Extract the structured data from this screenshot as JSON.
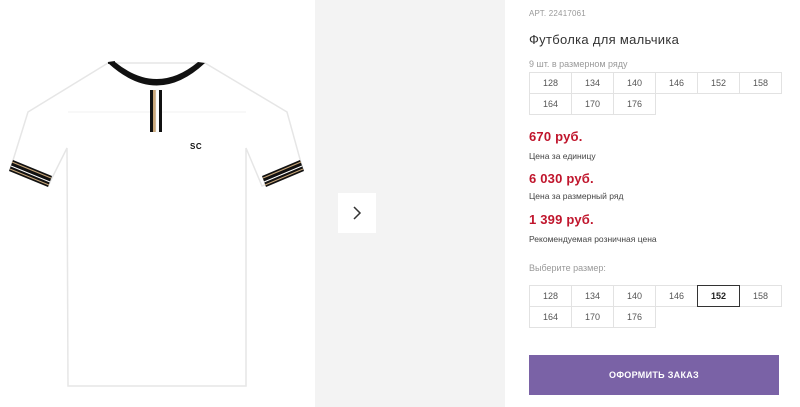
{
  "product": {
    "article": "АРТ. 22417061",
    "title": "Футболка для мальчика",
    "count_in_range": "9 шт. в размерном ряду",
    "range_sizes": [
      "128",
      "134",
      "140",
      "146",
      "152",
      "158",
      "164",
      "170",
      "176"
    ],
    "price_unit": "670 руб.",
    "price_unit_label": "Цена за единицу",
    "price_range": "6 030 руб.",
    "price_range_label": "Цена за размерный ряд",
    "price_retail": "1 399 руб.",
    "price_retail_label": "Рекомендуемая розничная цена",
    "choose_size_label": "Выберите размер:",
    "select_sizes": [
      "128",
      "134",
      "140",
      "146",
      "152",
      "158",
      "164",
      "170",
      "176"
    ],
    "selected_size": "152",
    "shirt_logo": "SC"
  },
  "actions": {
    "order_button": "ОФОРМИТЬ ЗАКАЗ"
  },
  "colors": {
    "accent": "#7a62a6",
    "price": "#c0152c"
  }
}
